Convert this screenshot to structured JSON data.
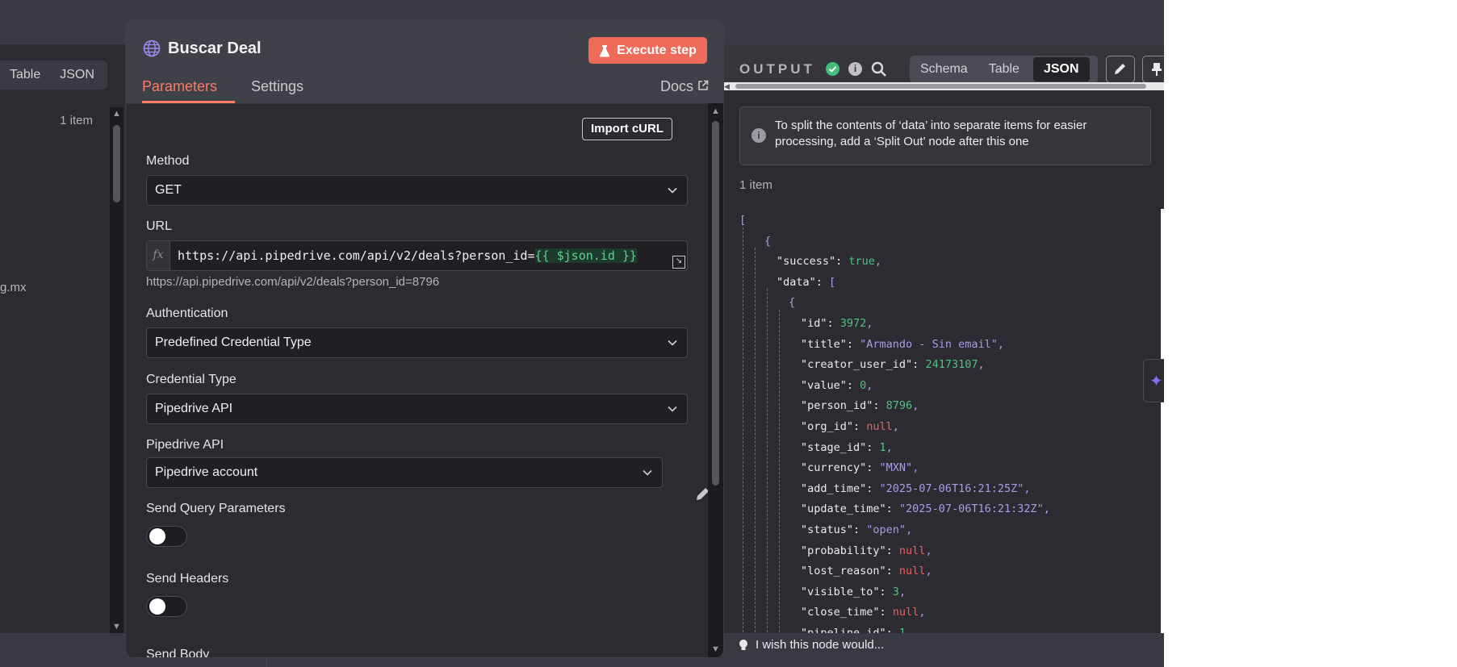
{
  "left_panel": {
    "tabs": [
      "Table",
      "JSON"
    ],
    "item_count": "1 item",
    "partial_text": "g.mx"
  },
  "node": {
    "title": "Buscar Deal",
    "execute_label": "Execute step",
    "tabs": {
      "parameters": "Parameters",
      "settings": "Settings",
      "docs": "Docs"
    },
    "import_curl_label": "Import cURL",
    "method": {
      "label": "Method",
      "value": "GET"
    },
    "url": {
      "label": "URL",
      "fx": "fx",
      "value_prefix": "https://api.pipedrive.com/api/v2/deals?person_id=",
      "value_expression": "{{ $json.id }}",
      "resolved": "https://api.pipedrive.com/api/v2/deals?person_id=8796"
    },
    "authentication": {
      "label": "Authentication",
      "value": "Predefined Credential Type"
    },
    "credential_type": {
      "label": "Credential Type",
      "value": "Pipedrive API"
    },
    "pipedrive_api": {
      "label": "Pipedrive API",
      "value": "Pipedrive account"
    },
    "send_query_params": {
      "label": "Send Query Parameters",
      "enabled": false
    },
    "send_headers": {
      "label": "Send Headers",
      "enabled": false
    },
    "send_body": {
      "label": "Send Body"
    }
  },
  "output": {
    "title": "OUTPUT",
    "tabs": [
      "Schema",
      "Table",
      "JSON"
    ],
    "active_tab": "JSON",
    "notice": "To split the contents of ‘data’ into separate items for easier processing, add a ‘Split Out’ node after this one",
    "item_count": "1 item",
    "json_lines": [
      {
        "indent": 0,
        "parts": [
          [
            "p",
            "["
          ]
        ]
      },
      {
        "indent": 1,
        "parts": [
          [
            "p",
            "{"
          ]
        ]
      },
      {
        "indent": 2,
        "parts": [
          [
            "k",
            "\"success\":"
          ],
          [
            "b",
            " true"
          ],
          [
            "p",
            ","
          ]
        ]
      },
      {
        "indent": 2,
        "parts": [
          [
            "k",
            "\"data\":"
          ],
          [
            "p",
            " ["
          ]
        ]
      },
      {
        "indent": 3,
        "parts": [
          [
            "p",
            "{"
          ]
        ]
      },
      {
        "indent": 4,
        "parts": [
          [
            "k",
            "\"id\":"
          ],
          [
            "n",
            " 3972"
          ],
          [
            "p",
            ","
          ]
        ]
      },
      {
        "indent": 4,
        "parts": [
          [
            "k",
            "\"title\":"
          ],
          [
            "s",
            " \"Armando - Sin email\""
          ],
          [
            "p",
            ","
          ]
        ]
      },
      {
        "indent": 4,
        "parts": [
          [
            "k",
            "\"creator_user_id\":"
          ],
          [
            "n",
            " 24173107"
          ],
          [
            "p",
            ","
          ]
        ]
      },
      {
        "indent": 4,
        "parts": [
          [
            "k",
            "\"value\":"
          ],
          [
            "n",
            " 0"
          ],
          [
            "p",
            ","
          ]
        ]
      },
      {
        "indent": 4,
        "parts": [
          [
            "k",
            "\"person_id\":"
          ],
          [
            "n",
            " 8796"
          ],
          [
            "p",
            ","
          ]
        ]
      },
      {
        "indent": 4,
        "parts": [
          [
            "k",
            "\"org_id\":"
          ],
          [
            "null",
            " null"
          ],
          [
            "p",
            ","
          ]
        ]
      },
      {
        "indent": 4,
        "parts": [
          [
            "k",
            "\"stage_id\":"
          ],
          [
            "n",
            " 1"
          ],
          [
            "p",
            ","
          ]
        ]
      },
      {
        "indent": 4,
        "parts": [
          [
            "k",
            "\"currency\":"
          ],
          [
            "s",
            " \"MXN\""
          ],
          [
            "p",
            ","
          ]
        ]
      },
      {
        "indent": 4,
        "parts": [
          [
            "k",
            "\"add_time\":"
          ],
          [
            "s",
            " \"2025-07-06T16:21:25Z\""
          ],
          [
            "p",
            ","
          ]
        ]
      },
      {
        "indent": 4,
        "parts": [
          [
            "k",
            "\"update_time\":"
          ],
          [
            "s",
            " \"2025-07-06T16:21:32Z\""
          ],
          [
            "p",
            ","
          ]
        ]
      },
      {
        "indent": 4,
        "parts": [
          [
            "k",
            "\"status\":"
          ],
          [
            "s",
            " \"open\""
          ],
          [
            "p",
            ","
          ]
        ]
      },
      {
        "indent": 4,
        "parts": [
          [
            "k",
            "\"probability\":"
          ],
          [
            "null",
            " null"
          ],
          [
            "p",
            ","
          ]
        ]
      },
      {
        "indent": 4,
        "parts": [
          [
            "k",
            "\"lost_reason\":"
          ],
          [
            "null",
            " null"
          ],
          [
            "p",
            ","
          ]
        ]
      },
      {
        "indent": 4,
        "parts": [
          [
            "k",
            "\"visible_to\":"
          ],
          [
            "n",
            " 3"
          ],
          [
            "p",
            ","
          ]
        ]
      },
      {
        "indent": 4,
        "parts": [
          [
            "k",
            "\"close_time\":"
          ],
          [
            "null",
            " null"
          ],
          [
            "p",
            ","
          ]
        ]
      },
      {
        "indent": 4,
        "parts": [
          [
            "k",
            "\"pipeline_id\":"
          ],
          [
            "n",
            " 1"
          ],
          [
            "p",
            ","
          ]
        ]
      }
    ]
  },
  "feedback": {
    "label": "I wish this node would..."
  },
  "colors": {
    "accent": "#ff7a67",
    "execute_bg": "#ee6b5a",
    "success": "#3fbf7a",
    "json_string": "#a79ee8",
    "json_number": "#4fc285",
    "json_null": "#f25d5d"
  },
  "icons": [
    "globe-icon",
    "flask-icon",
    "external-link-icon",
    "chevron-down-icon",
    "pencil-icon",
    "check-circle-icon",
    "info-icon",
    "search-icon",
    "pin-icon",
    "sparkle-icon",
    "lightbulb-icon",
    "expand-icon"
  ]
}
